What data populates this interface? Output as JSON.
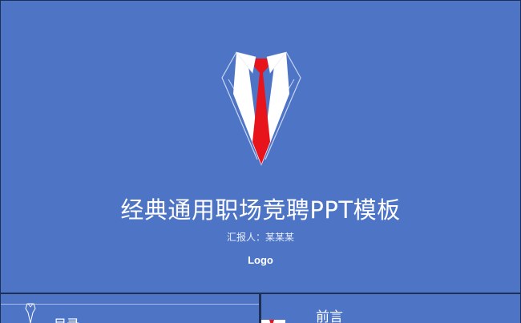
{
  "slide": {
    "title": "经典通用职场竞聘PPT模板",
    "reporter": "汇报人：某某某",
    "logo": "Logo",
    "emblem_icon": "suit-tie-icon"
  },
  "thumbnails": [
    {
      "label": "目录"
    },
    {
      "label": "前言"
    }
  ],
  "colors": {
    "background": "#4e74c6",
    "tie": "#e8141b",
    "text": "#ffffff",
    "border": "#1e2f55"
  }
}
